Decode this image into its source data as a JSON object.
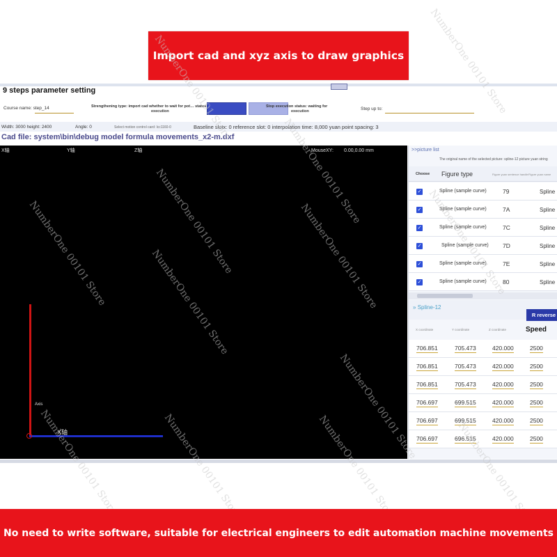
{
  "top_banner": "Import cad and xyz axis to draw graphics",
  "bottom_banner": "No need to write software, suitable for electrical engineers to edit automation machine movements",
  "app": {
    "title": "9 steps parameter setting",
    "course_name_label": "Course name: step_14",
    "strengthening_type": "Strengthening type: import cad whether to wait for pot… status",
    "strengthening_sub": "execution",
    "stop_status": "Stop execution status: waiting for",
    "stop_sub": "execution",
    "step_up_label": "Step up to:",
    "info_size": "Width: 3000 height: 2400",
    "info_angle": "Angle: 0",
    "info_card": "Select motion control card: lcc1160-0",
    "info_baseline": "Baseline slotx: 0 reference slot: 0 interpolation time: 8,000 yuan point spacing: 3",
    "cad_file": "Cad file: system\\bin\\debug model formula movements_x2-m.dxf"
  },
  "canvas": {
    "x_axis_tag": "X轴",
    "y_axis_tag": "Y轴",
    "z_axis_tag": "Z轴",
    "mouse_label": "MouseXY:",
    "mouse_value": "0.00,0.00 mm",
    "axis_label": "Axis",
    "x_axis_label": "X轴"
  },
  "picture_list": {
    "header": ">>picture list",
    "selected_desc": "The original name of the selected picture: spline-12 picture yuan string",
    "col_choose": "Choose",
    "col_type": "Figure type",
    "col_code": "Figure yuan sentence handle",
    "col_name": "Figure yuan name",
    "rows": [
      {
        "type": "Spline (sample curve)",
        "code": "79",
        "name": "Spline"
      },
      {
        "type": "Spline (sample curve)",
        "code": "7A",
        "name": "Spline"
      },
      {
        "type": "Spline (sample curve)",
        "code": "7C",
        "name": "Spline"
      },
      {
        "type": "Spline (sample curve)",
        "code": "7D",
        "name": "Spline"
      },
      {
        "type": "Spline (sample curve)",
        "code": "7E",
        "name": "Spline"
      },
      {
        "type": "Spline (sample curve)",
        "code": "80",
        "name": "Spline"
      }
    ]
  },
  "spline": {
    "title": "Spline-12",
    "reverse_button": "R reverse",
    "col_x": "X coordinate",
    "col_y": "Y coordinate",
    "col_z": "Z coordinate",
    "col_speed": "Speed",
    "rows": [
      {
        "x": "706.851",
        "y": "705.473",
        "z": "420.000",
        "speed": "2500"
      },
      {
        "x": "706.851",
        "y": "705.473",
        "z": "420.000",
        "speed": "2500"
      },
      {
        "x": "706.851",
        "y": "705.473",
        "z": "420.000",
        "speed": "2500"
      },
      {
        "x": "706.697",
        "y": "699.515",
        "z": "420.000",
        "speed": "2500"
      },
      {
        "x": "706.697",
        "y": "699.515",
        "z": "420.000",
        "speed": "2500"
      },
      {
        "x": "706.697",
        "y": "696.515",
        "z": "420.000",
        "speed": "2500"
      }
    ]
  },
  "watermark": "NumberOne 00101 Store",
  "colors": {
    "banner": "#e8141b",
    "canvas": "#000000",
    "accent": "#2d4fd8"
  }
}
